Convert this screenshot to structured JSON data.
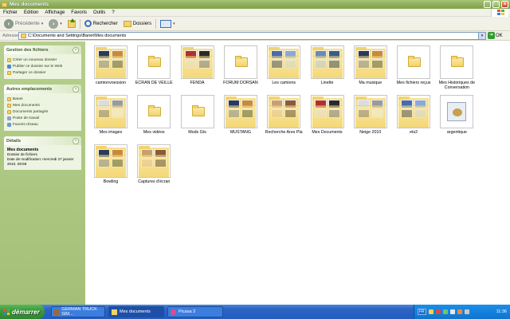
{
  "window": {
    "title": "Mes documents"
  },
  "menu": [
    "Fichier",
    "Edition",
    "Affichage",
    "Favoris",
    "Outils",
    "?"
  ],
  "toolbar": {
    "back": "Précédente",
    "search": "Rechercher",
    "folders": "Dossiers"
  },
  "address": {
    "label": "Adresse",
    "path": "C:\\Documents and Settings\\Banet\\Mes documents",
    "go": "OK"
  },
  "sidebar": {
    "file_tasks": {
      "title": "Gestion des fichiers",
      "items": [
        "Créer un nouveau dossier",
        "Publier ce dossier sur le Web",
        "Partager ce dossier"
      ]
    },
    "other_places": {
      "title": "Autres emplacements",
      "items": [
        "Banet",
        "Mes documents",
        "Documents partagés",
        "Poste de travail",
        "Favoris réseau"
      ]
    },
    "details": {
      "title": "Détails",
      "name": "Mes documents",
      "type": "Dossier de fichiers",
      "modified": "Date de modification: mercredi 27 janvier 2010, 08:58"
    }
  },
  "items": [
    {
      "name": "camionvoession",
      "kind": "photos"
    },
    {
      "name": "ECRAN DE VEILLE",
      "kind": "empty"
    },
    {
      "name": "FENDA",
      "kind": "photos"
    },
    {
      "name": "FORUM DORSAN",
      "kind": "empty"
    },
    {
      "name": "Les camions",
      "kind": "photos"
    },
    {
      "name": "Linette",
      "kind": "photos"
    },
    {
      "name": "Ma musique",
      "kind": "photos"
    },
    {
      "name": "Mes fichiers reçus",
      "kind": "empty"
    },
    {
      "name": "Mes Historiques de Conversation",
      "kind": "empty"
    },
    {
      "name": "Mes images",
      "kind": "photos"
    },
    {
      "name": "Mes vidéos",
      "kind": "empty"
    },
    {
      "name": "Mods Gts",
      "kind": "empty"
    },
    {
      "name": "MUSTANG",
      "kind": "photos"
    },
    {
      "name": "Recherche Ares Pla",
      "kind": "photos"
    },
    {
      "name": "Mes Documents",
      "kind": "photos"
    },
    {
      "name": "Neige 2010",
      "kind": "photos"
    },
    {
      "name": "ets2",
      "kind": "photos"
    },
    {
      "name": "argentique",
      "kind": "file"
    },
    {
      "name": "Bowling",
      "kind": "photos"
    },
    {
      "name": "Captures d'écran",
      "kind": "photos"
    }
  ],
  "taskbar": {
    "start": "démarrer",
    "tasks": [
      "GERMAN TRUCK SIM...",
      "Mes documents",
      "Picasa 3"
    ],
    "lang": "FR",
    "clock": "11:36"
  }
}
